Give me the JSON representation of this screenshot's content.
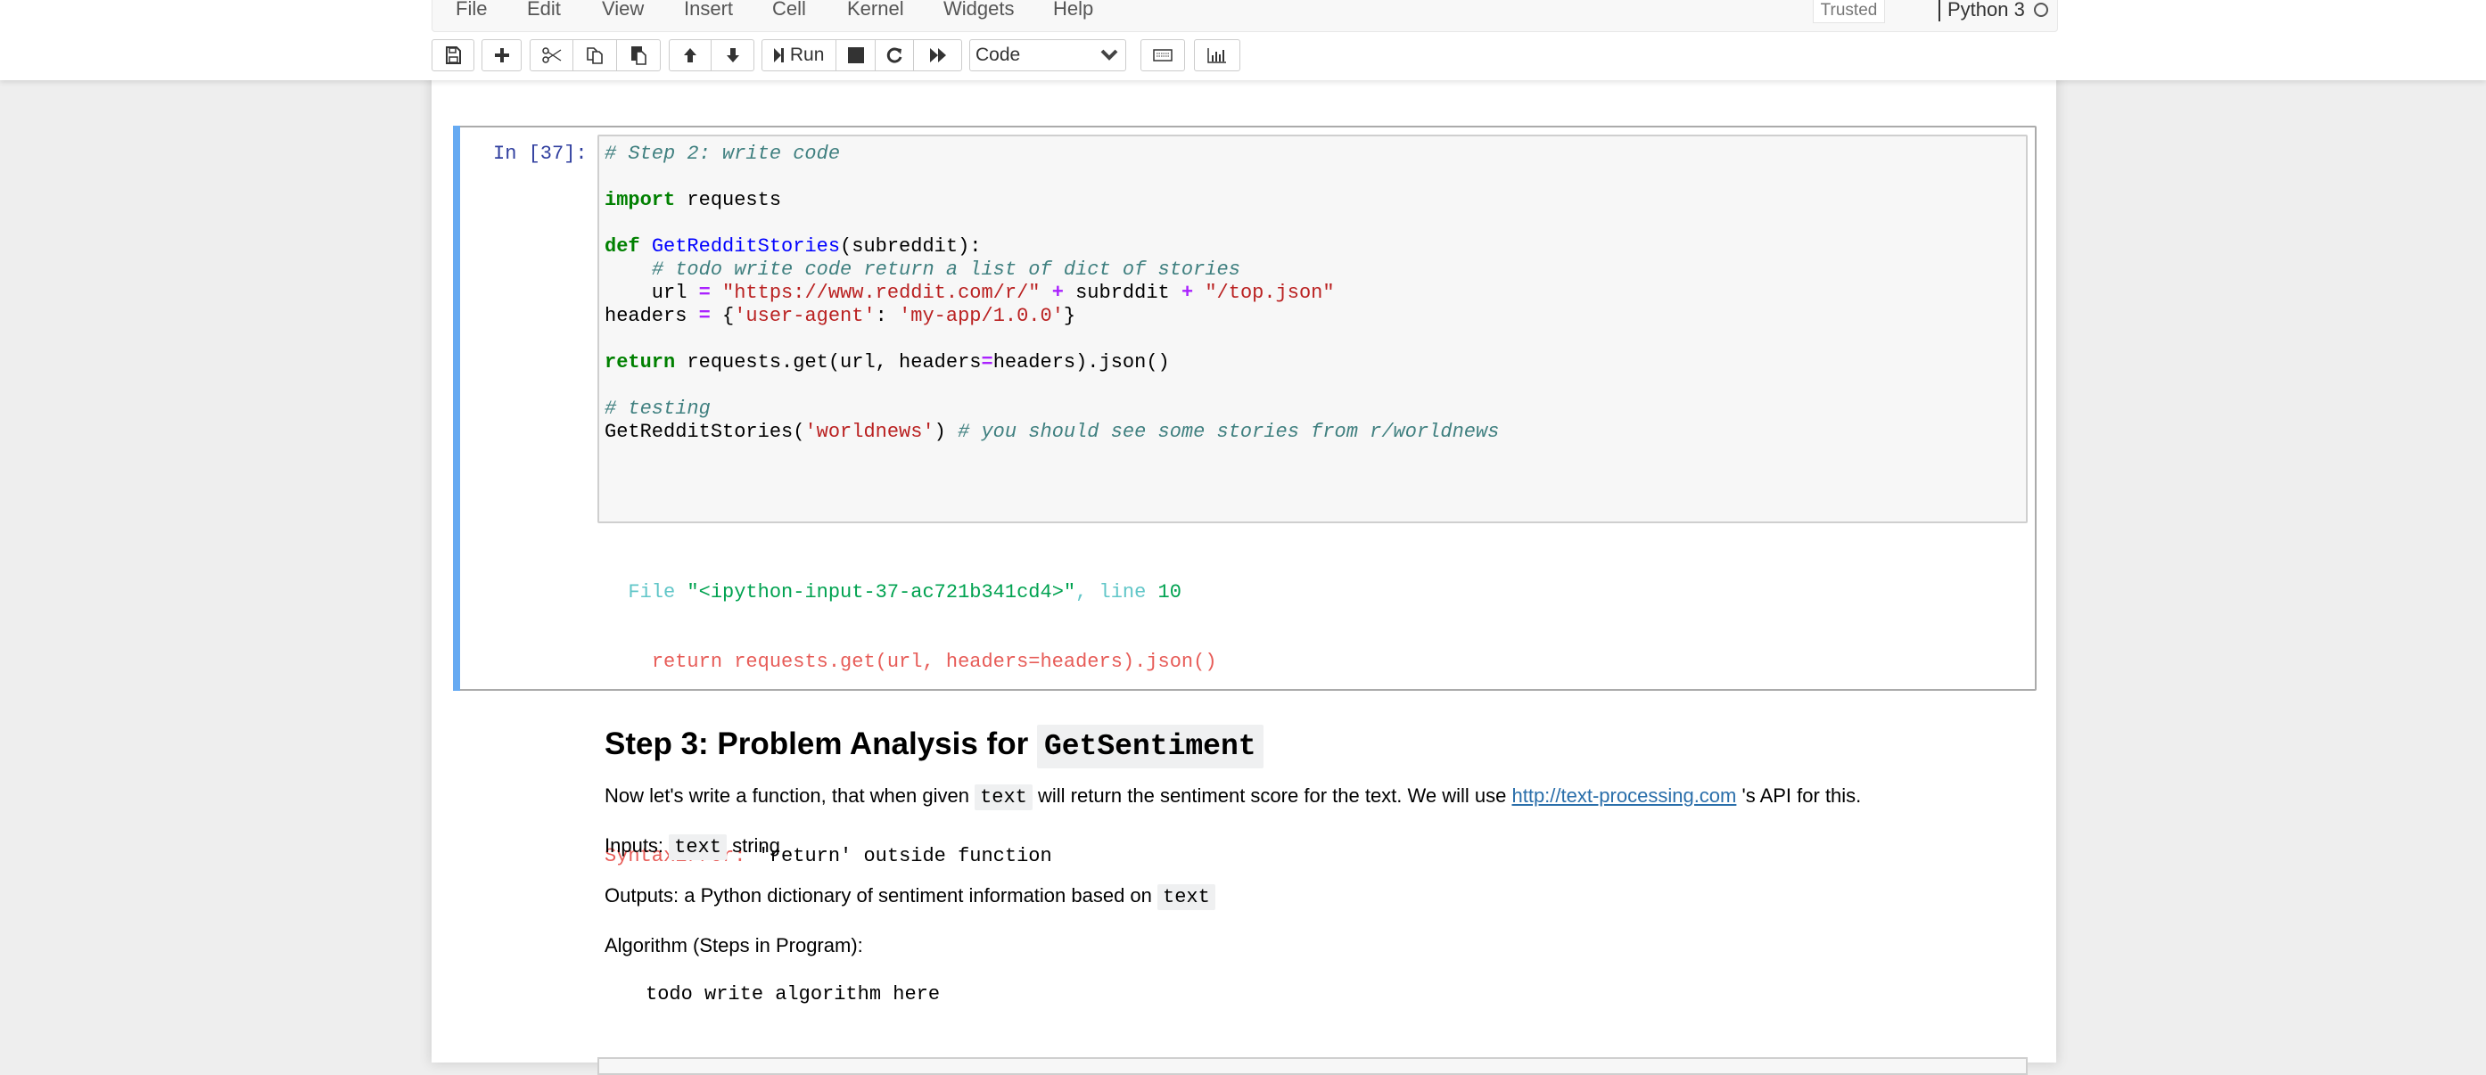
{
  "menu": {
    "items": [
      "File",
      "Edit",
      "View",
      "Insert",
      "Cell",
      "Kernel",
      "Widgets",
      "Help"
    ],
    "trusted": "Trusted",
    "kernel": "Python 3"
  },
  "toolbar": {
    "run_label": "Run",
    "cell_type": "Code"
  },
  "cell": {
    "prompt": "In [37]:",
    "code_lines": [
      "# Step 2: write code",
      "",
      "import requests",
      "",
      "def GetRedditStories(subreddit):",
      "    # todo write code return a list of dict of stories",
      "    url = \"https://www.reddit.com/r/\" + subrddit + \"/top.json\"",
      "headers = {'user-agent': 'my-app/1.0.0'}",
      "",
      "return requests.get(url, headers=headers).json()",
      "",
      "# testing",
      "GetRedditStories('worldnews') # you should see some stories from r/worldnews"
    ],
    "output": {
      "file_prefix": "File ",
      "file_name": "\"<ipython-input-37-ac721b341cd4>\"",
      "line_label": ", line ",
      "line_num": "10",
      "error_line": "return requests.get(url, headers=headers).json()",
      "caret": "^",
      "error_type": "SyntaxError:",
      "error_msg": " 'return' outside function"
    }
  },
  "markdown": {
    "heading": "Step 3: Problem Analysis for ",
    "heading_code": "GetSentiment",
    "p1_a": "Now let's write a function, that when given ",
    "p1_code": "text",
    "p1_b": " will return the sentiment score for the text. We will use ",
    "p1_link": "http://text-processing.com",
    "p1_c": " 's API for this.",
    "inputs_a": "Inputs: ",
    "inputs_code": "text",
    "inputs_b": " string",
    "outputs_a": "Outputs: a Python dictionary of sentiment information based on ",
    "outputs_code": "text",
    "algo": "Algorithm (Steps in Program):",
    "algo_code": "todo write algorithm here"
  }
}
